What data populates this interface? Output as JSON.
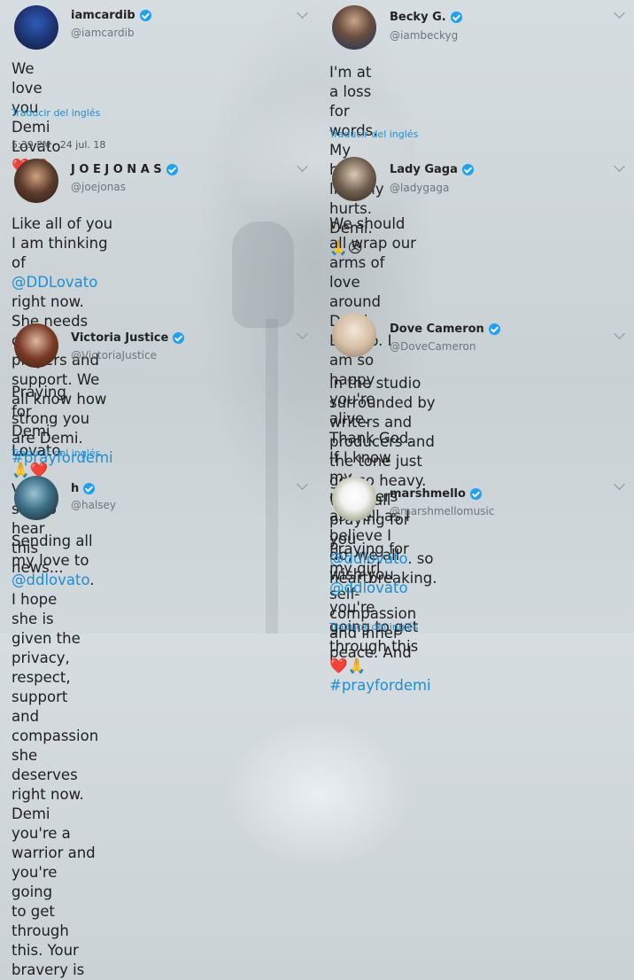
{
  "tweets": [
    {
      "name": "iamcardib",
      "handle": "@iamcardib",
      "text": "We love you Demi Lovato ❤️❤️",
      "translate": "Traducir del inglés",
      "timestamp": "5:39 PM · 24 jul. 18"
    },
    {
      "name": "Becky G.",
      "handle": "@iambeckyg",
      "text_l1": "I'm at a loss for words. My heart literally",
      "text_l2": "hurts. Demi. 🙏😣",
      "translate": "Traducir del inglés"
    },
    {
      "name": "J O E  J O N A S",
      "handle": "@joejonas",
      "text_l1": "Like all of you I am thinking of",
      "mention": "@DDLovato",
      "text_l2b": " right now. She needs our",
      "text_l3": "prayers and support. We all know how",
      "text_l4a": "strong you are Demi. ",
      "hashtag": "#prayfordemi"
    },
    {
      "name": "Lady Gaga",
      "handle": "@ladygaga",
      "text_l1": "We should all wrap our arms of love",
      "text_l2": "around Demi Lovato. I am so happy you're",
      "text_l3": "alive. Thank God. If I know my monsters",
      "text_l4": "as well as I believe I do, we all wish you",
      "text_l5": "self-compassion and inner peace. And"
    },
    {
      "name": "Victoria Justice",
      "handle": "@VictoriaJustice",
      "text_l1": "Praying for Demi Lovato 🙏❤️",
      "text_l2": "Very sad to hear this news...",
      "translate": "Traducir del inglés"
    },
    {
      "name": "Dove Cameron",
      "handle": "@DoveCameron",
      "text_l1": "in the studio surrounded by writers and",
      "text_l2": "producers and the tone just got so heavy.",
      "text_l3a": "we're all praying for you ",
      "mention": "@ddlovato",
      "text_l3b": ". so",
      "text_l4": "heartbreaking."
    },
    {
      "name": "h",
      "handle": "@halsey",
      "text_l1a": "Sending all my love to ",
      "mention": "@ddlovato",
      "text_l1b": ". I hope",
      "text_l2": "she is given the privacy, respect, support",
      "text_l3": "and compassion she deserves right now.",
      "text_l4": "Demi you're a warrior and you're going",
      "text_l5": "to get through this. Your bravery is"
    },
    {
      "name": "marshmello",
      "handle": "@marshmellomusic",
      "text_l1a": "Praying for my girl ",
      "mention": "@ddlovato",
      "text_l1b": " you're",
      "text_l2": "going to get through this ❤️🙏",
      "hashtag": "#prayfordemi",
      "translate": "Traducir del inglés"
    }
  ]
}
